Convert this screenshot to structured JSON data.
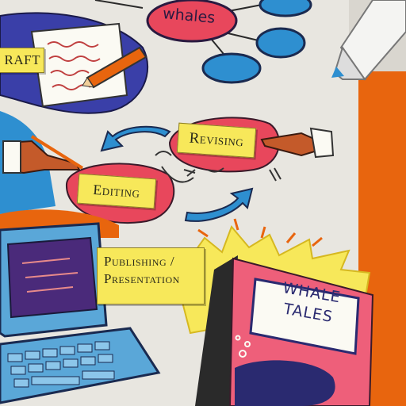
{
  "labels": {
    "whales": "whales",
    "draft": "RAFT",
    "revising": "Revising",
    "editing": "Editing",
    "publishing": "Publishing /",
    "presentation": "Presentation"
  },
  "book": {
    "title_line1": "WHALE",
    "title_line2": "TALES"
  },
  "colors": {
    "background": "#e8e6e0",
    "orange_panel": "#e8650e",
    "blue_bubble": "#2e8fd0",
    "red_bubble": "#e8475c",
    "label_yellow": "#f7e85a",
    "book_pink": "#ee5f7a",
    "computer_blue": "#5aa7d8",
    "screen_purple": "#4a2a7a"
  }
}
